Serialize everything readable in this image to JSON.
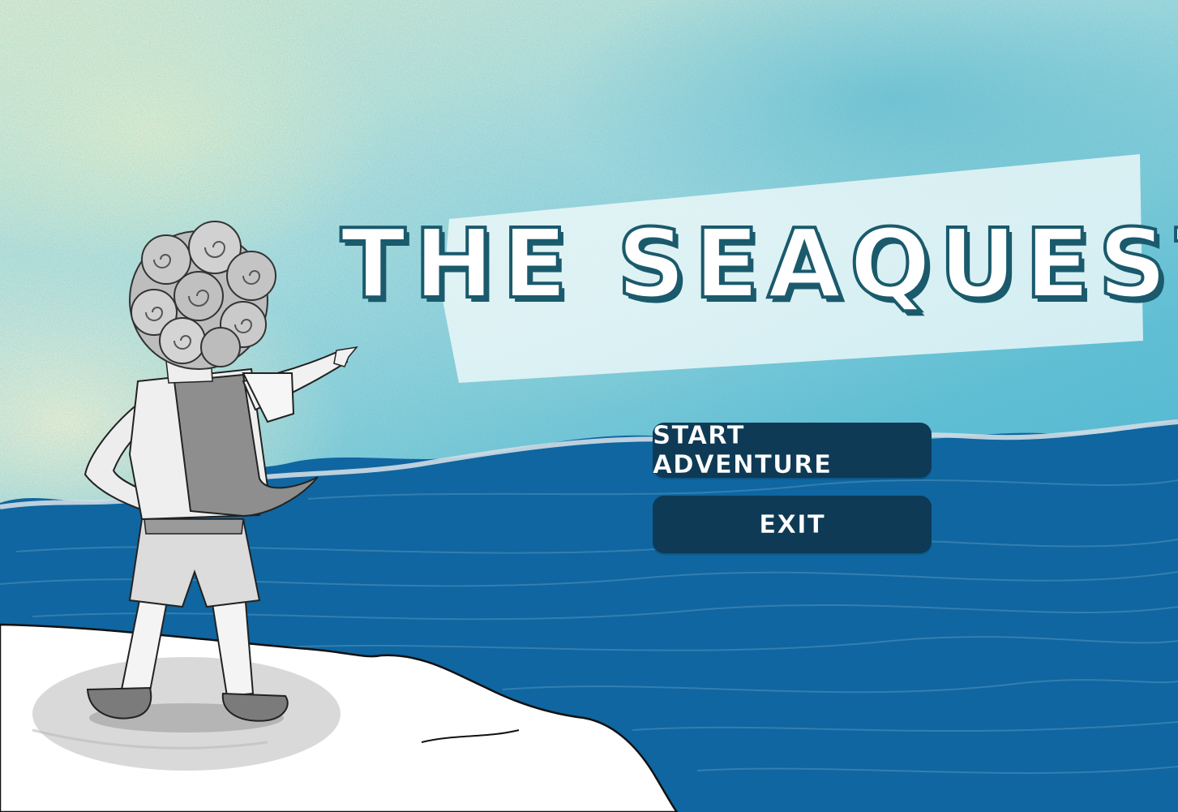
{
  "game": {
    "title": "THE SEAQUEST"
  },
  "menu": {
    "start_label": "START ADVENTURE",
    "exit_label": "EXIT"
  },
  "colors": {
    "sky_light": "#d6e8cf",
    "sky_deep": "#3fb0cf",
    "sea": "#0f66a0",
    "button_bg": "#0e3a55",
    "title_outline": "#1a5a6c",
    "cliff": "#ffffff"
  }
}
